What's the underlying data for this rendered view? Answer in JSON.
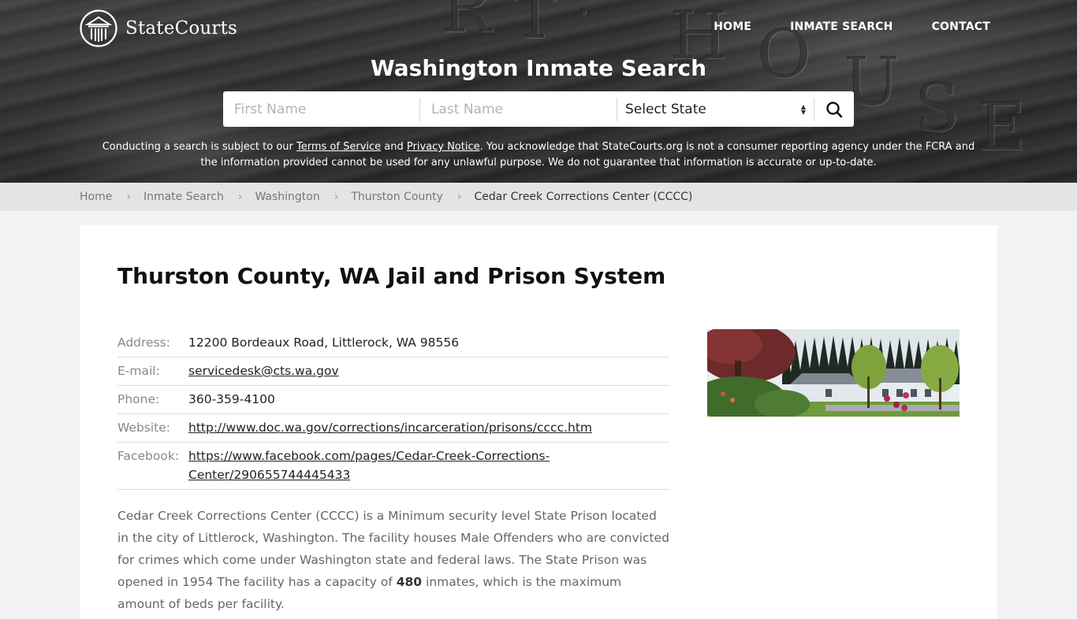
{
  "brand": {
    "name": "StateCourts",
    "logo_icon": "courthouse-columns-icon"
  },
  "nav": {
    "items": [
      {
        "label": "HOME"
      },
      {
        "label": "INMATE SEARCH"
      },
      {
        "label": "CONTACT"
      }
    ]
  },
  "hero": {
    "title": "Washington Inmate Search",
    "background_letters": [
      "R",
      "T",
      "·",
      "H",
      "O",
      "U",
      "S",
      "E"
    ]
  },
  "search": {
    "first_name_placeholder": "First Name",
    "first_name_value": "",
    "last_name_placeholder": "Last Name",
    "last_name_value": "",
    "state_select_value": "Select State",
    "search_icon": "magnifier-icon"
  },
  "disclaimer": {
    "prefix": "Conducting a search is subject to our ",
    "terms_link": "Terms of Service",
    "and": " and ",
    "privacy_link": "Privacy Notice",
    "suffix": ". You acknowledge that StateCourts.org is not a consumer reporting agency under the FCRA and the information provided cannot be used for any unlawful purpose. We do not guarantee that information is accurate or up-to-date."
  },
  "breadcrumb": {
    "items": [
      {
        "label": "Home"
      },
      {
        "label": "Inmate Search"
      },
      {
        "label": "Washington"
      },
      {
        "label": "Thurston County"
      }
    ],
    "current": "Cedar Creek Corrections Center (CCCC)",
    "separator": "›"
  },
  "main": {
    "title": "Thurston County, WA Jail and Prison System",
    "info": {
      "address_label": "Address:",
      "address_value": "12200 Bordeaux Road, Littlerock, WA 98556",
      "email_label": "E-mail:",
      "email_value": "servicedesk@cts.wa.gov",
      "phone_label": "Phone:",
      "phone_value": "360-359-4100",
      "website_label": "Website:",
      "website_value": "http://www.doc.wa.gov/corrections/incarceration/prisons/cccc.htm",
      "facebook_label": "Facebook:",
      "facebook_value_line1": "https://www.facebook.com/pages/Cedar-Creek-Corrections-",
      "facebook_value_line2": "Center/290655744445433"
    },
    "photo_alt": "Cedar Creek Corrections Center facility photo",
    "description": {
      "before_capacity": "Cedar Creek Corrections Center (CCCC) is a Minimum security level State Prison located in the city of Littlerock, Washington. The facility houses Male Offenders who are convicted for crimes which come under Washington state and federal laws. The State Prison was opened in 1954 The facility has a capacity of ",
      "capacity": "480",
      "after_capacity": " inmates, which is the maximum amount of beds per facility."
    }
  },
  "colors": {
    "hero_overlay": "#3c3c3c",
    "breadcrumb_bg": "#e4e4e4",
    "page_bg": "#f3f3f3",
    "card_bg": "#ffffff",
    "label_gray": "#888888"
  }
}
